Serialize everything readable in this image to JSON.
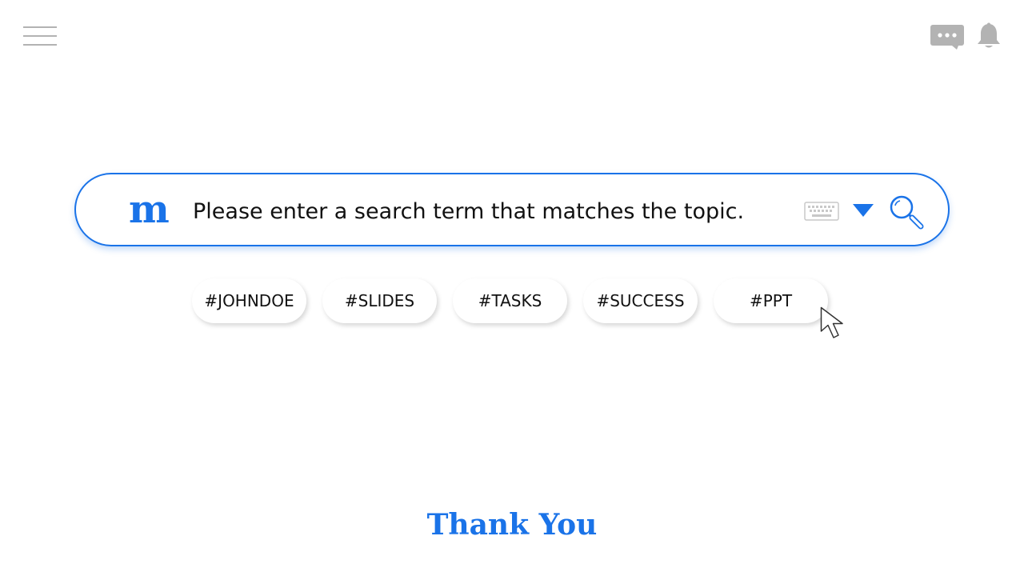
{
  "header": {
    "menu_icon": "hamburger-menu-icon",
    "chat_icon": "chat-bubble-icon",
    "notification_icon": "bell-icon"
  },
  "search": {
    "logo_text": "m",
    "placeholder": "Please enter a search term that matches the topic.",
    "keyboard_icon": "keyboard-icon",
    "dropdown_icon": "dropdown-triangle-icon",
    "search_icon": "magnifier-icon"
  },
  "tags": [
    {
      "label": "#JOHNDOE"
    },
    {
      "label": "#SLIDES"
    },
    {
      "label": "#TASKS"
    },
    {
      "label": "#SUCCESS"
    },
    {
      "label": "#PPT"
    }
  ],
  "footer": {
    "title": "Thank You"
  },
  "colors": {
    "accent": "#1a73e8",
    "icon_gray": "#b3b3b3",
    "text": "#111111"
  }
}
